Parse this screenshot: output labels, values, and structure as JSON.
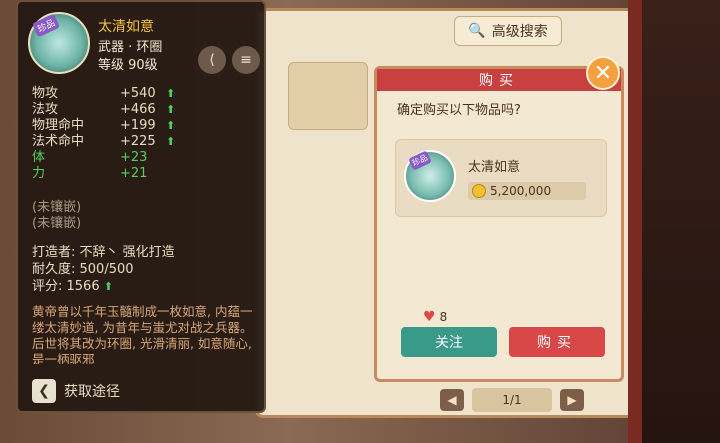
{
  "background": {
    "search_label": "高级搜索",
    "pager": "1/1"
  },
  "tooltip": {
    "badge": "珍品",
    "name": "太清如意",
    "type": "武器 · 环圈",
    "level": "等级 90级",
    "stats": [
      {
        "label": "物攻",
        "value": "+540",
        "arrow": true
      },
      {
        "label": "法攻",
        "value": "+466",
        "arrow": true
      },
      {
        "label": "物理命中",
        "value": "+199",
        "arrow": true
      },
      {
        "label": "法术命中",
        "value": "+225",
        "arrow": true
      }
    ],
    "bonus": [
      {
        "label": "体",
        "value": "+23"
      },
      {
        "label": "力",
        "value": "+21"
      }
    ],
    "gems": [
      "(未镶嵌)",
      "(未镶嵌)"
    ],
    "maker": "打造者: 不辞丶 强化打造",
    "durability": "耐久度: 500/500",
    "score": "评分: 1566",
    "description": "黄帝曾以千年玉髓制成一枚如意, 内蕴一缕太清妙道, 为昔年与蚩尤对战之兵器。后世将其改为环圈, 光滑清丽, 如意随心, 是一柄驱邪",
    "source_label": "获取途径"
  },
  "dialog": {
    "title": "购买",
    "question": "确定购买以下物品吗?",
    "badge": "珍品",
    "item_name": "太清如意",
    "price": "5,200,000",
    "likes": "8",
    "follow_label": "关注",
    "buy_label": "购买"
  }
}
